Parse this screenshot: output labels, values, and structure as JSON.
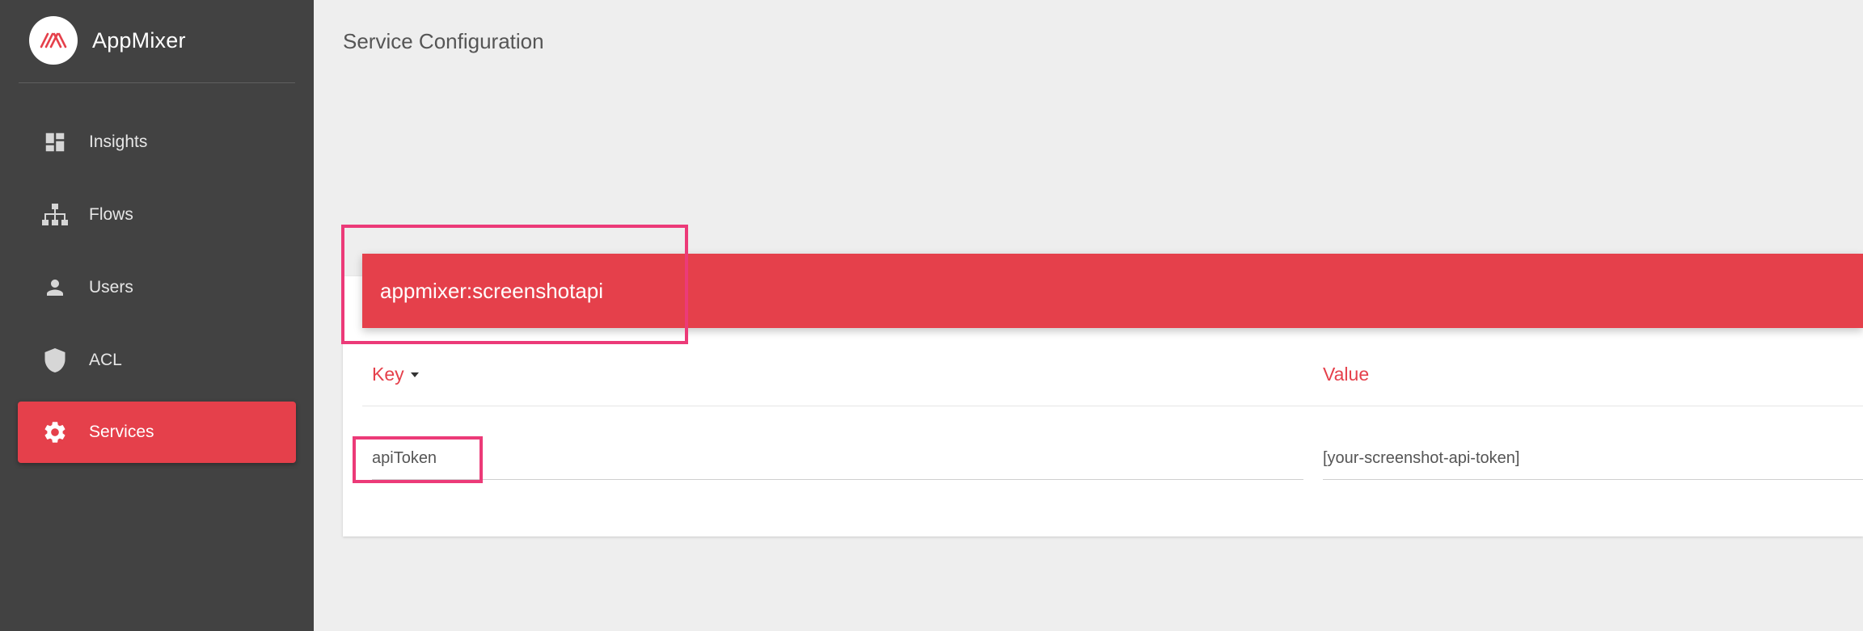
{
  "app": {
    "name": "AppMixer",
    "accent_color": "#e5404b",
    "sidebar_color": "#424242",
    "highlight_color": "#ec3a78"
  },
  "sidebar": {
    "items": [
      {
        "label": "Insights",
        "icon": "dashboard-icon",
        "active": false
      },
      {
        "label": "Flows",
        "icon": "sitemap-icon",
        "active": false
      },
      {
        "label": "Users",
        "icon": "person-icon",
        "active": false
      },
      {
        "label": "ACL",
        "icon": "shield-icon",
        "active": false
      },
      {
        "label": "Services",
        "icon": "gear-icon",
        "active": true
      }
    ]
  },
  "main": {
    "title": "Service Configuration",
    "service": {
      "name": "appmixer:screenshotapi"
    },
    "table": {
      "columns": {
        "key": "Key",
        "value": "Value"
      },
      "rows": [
        {
          "key": "apiToken",
          "value": "[your-screenshot-api-token]"
        }
      ]
    }
  }
}
